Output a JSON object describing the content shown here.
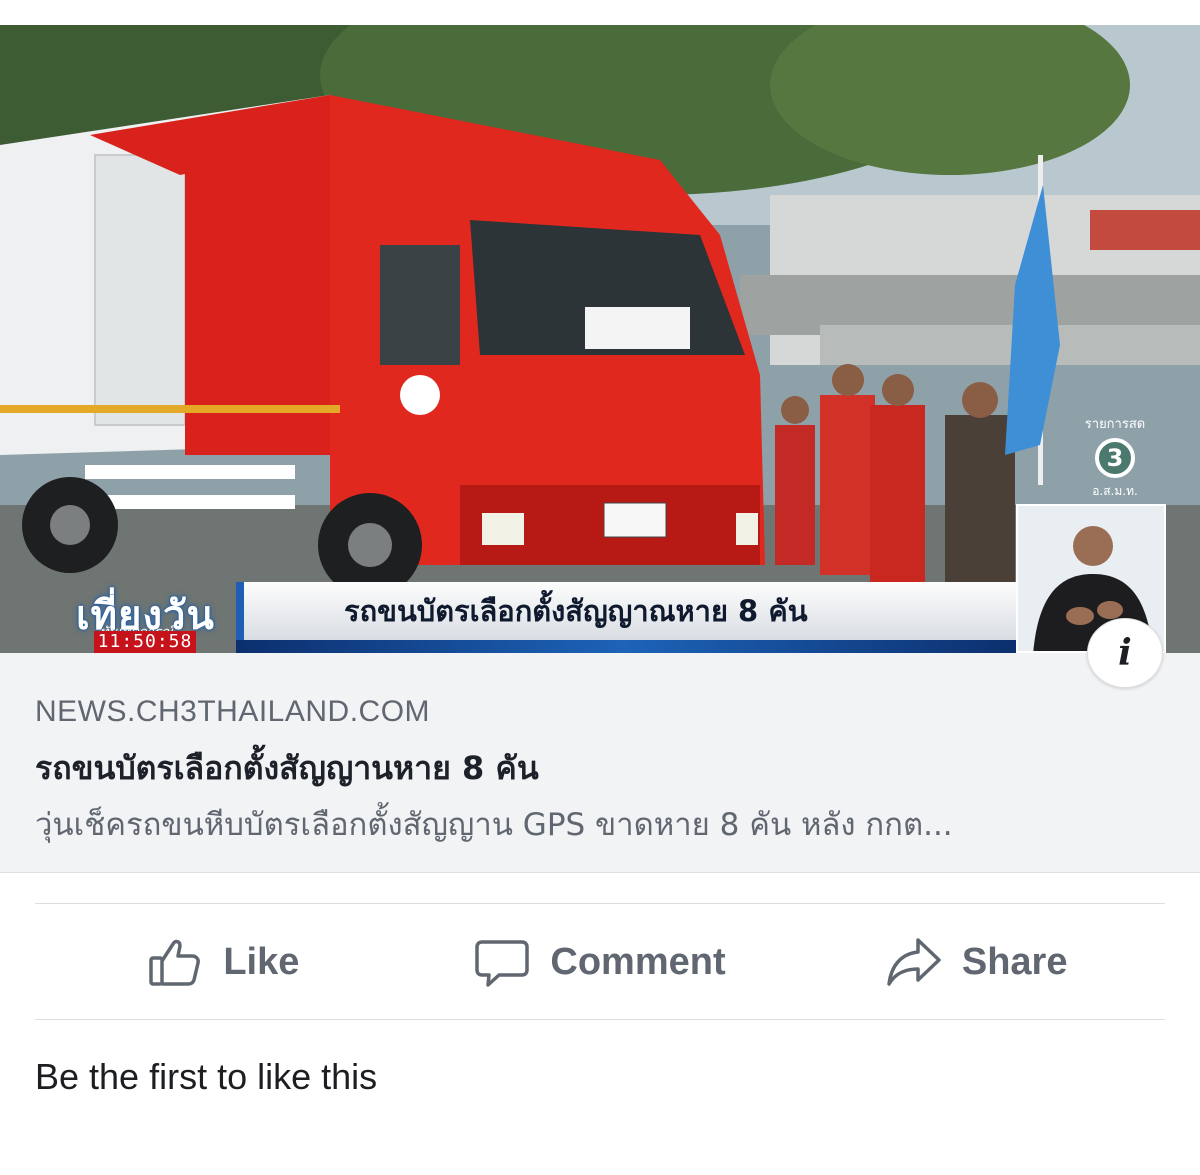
{
  "media": {
    "show_name": "เที่ยงวัน",
    "show_subtitle": "ทันเหตุการณ์",
    "clock": "11:50:58",
    "headline": "รถขนบัตรเลือกตั้งสัญญาณหาย 8 คัน",
    "channel_live": "รายการสด",
    "channel_number": "3",
    "channel_org": "อ.ส.ม.ท.",
    "info_icon": "info-icon"
  },
  "preview": {
    "domain": "NEWS.CH3THAILAND.COM",
    "title": "รถขนบัตรเลือกตั้งสัญญานหาย 8 คัน",
    "description": "วุ่นเช็ครถขนหีบบัตรเลือกตั้งสัญญาน GPS ขาดหาย 8 คัน หลัง กกต..."
  },
  "actions": {
    "like": {
      "label": "Like",
      "icon": "thumbs-up-icon"
    },
    "comment": {
      "label": "Comment",
      "icon": "comment-bubble-icon"
    },
    "share": {
      "label": "Share",
      "icon": "share-arrow-icon"
    }
  },
  "reactions": {
    "summary": "Be the first to like this"
  },
  "colors": {
    "muted": "#606770",
    "preview_bg": "#f2f3f5",
    "truck_red": "#d8221b"
  }
}
